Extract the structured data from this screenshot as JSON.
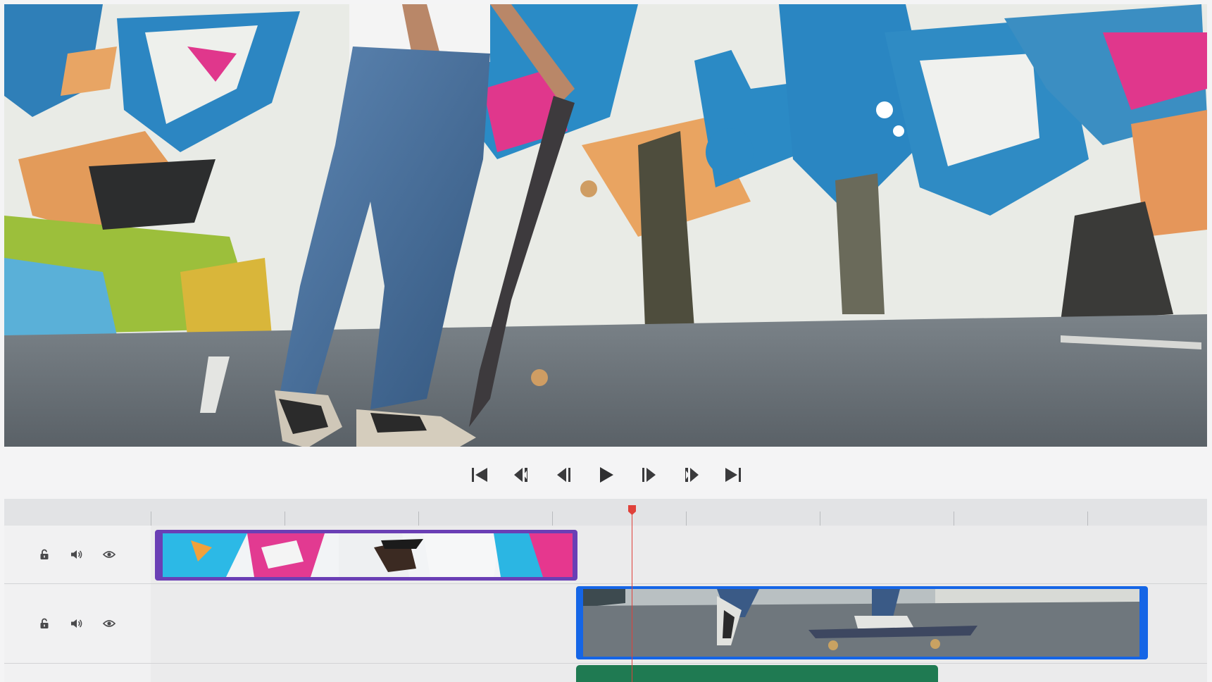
{
  "preview": {
    "scene": "skateboarder-video-frame"
  },
  "transport": {
    "buttons": [
      {
        "name": "skip-to-start",
        "icon": "skip-start-icon"
      },
      {
        "name": "previous-marker",
        "icon": "rewind-icon"
      },
      {
        "name": "step-back",
        "icon": "step-back-icon"
      },
      {
        "name": "play",
        "icon": "play-icon"
      },
      {
        "name": "step-forward",
        "icon": "step-forward-icon"
      },
      {
        "name": "next-marker",
        "icon": "fast-forward-icon"
      },
      {
        "name": "skip-to-end",
        "icon": "skip-end-icon"
      }
    ],
    "icon_color": "#3a3a3c"
  },
  "timeline": {
    "tracks": [
      {
        "name": "track-1",
        "controls": [
          "lock-icon",
          "volume-icon",
          "eye-icon"
        ]
      },
      {
        "name": "track-2",
        "controls": [
          "lock-icon",
          "volume-icon",
          "eye-icon"
        ]
      },
      {
        "name": "track-3",
        "controls": []
      }
    ],
    "clips": [
      {
        "name": "graffiti-portrait-clip",
        "track": 1,
        "color": "#6a3fb5"
      },
      {
        "name": "skateboard-clip",
        "track": 2,
        "color": "#1565e6",
        "selected": true
      },
      {
        "name": "audio-clip",
        "track": 3,
        "color": "#1f7a52"
      }
    ],
    "playhead_color": "#e0413a"
  }
}
